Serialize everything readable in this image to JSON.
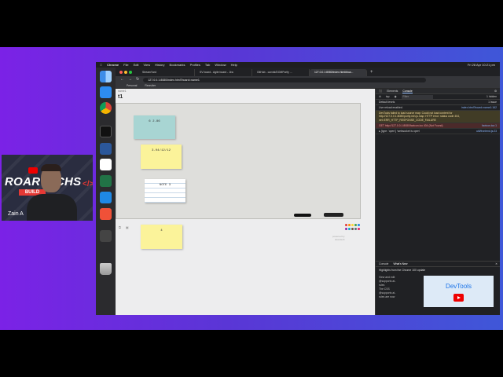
{
  "menubar": {
    "app": "Chrome",
    "items": [
      "File",
      "Edit",
      "View",
      "History",
      "Bookmarks",
      "Profiles",
      "Tab",
      "Window",
      "Help"
    ],
    "clock": "Fri 28 Apr 10:21 pm"
  },
  "tabs": [
    {
      "label": "StreamYard"
    },
    {
      "label": "SV board - Agile board - Jira"
    },
    {
      "label": "GitHub - curvist/DOMPurify ..."
    },
    {
      "label": "127.0.0.1:8080/index.html#boa..."
    }
  ],
  "toolbar": {
    "url": "127.0.0.1:8080/index.html?board=name1"
  },
  "bookmarks": [
    "Personal",
    "Recruiter"
  ],
  "page": {
    "label": "name1",
    "title": "t1",
    "notes": [
      {
        "text": "6 2.86"
      },
      {
        "text": "3.04/12/12"
      },
      {
        "text": "NOTE 3"
      },
      {
        "text": "4"
      }
    ],
    "watermark": [
      "powered by",
      "dowelsoft"
    ],
    "colors": [
      "#e53935",
      "#fb8c00",
      "#fdd835",
      "#43a047",
      "#1e88e5",
      "#8e24aa",
      "#00acc1",
      "#6d4c41",
      "#546e7a",
      "#e91e63"
    ]
  },
  "devtools": {
    "tabs": [
      "Elements",
      "Console"
    ],
    "context": "top",
    "filter_placeholder": "Filter",
    "issues": "1 Issue",
    "levels": "Default levels",
    "hidden": "1 hidden",
    "logs": [
      {
        "kind": "info",
        "text": "Live reload enabled.",
        "src": "index.html?board=name1:162"
      },
      {
        "kind": "warn",
        "text": "DevTools failed to load source map: Could not load content for http://127.0.0.1:8080/purify.min.js.map: HTTP error: status code 404, net::ERR_HTTP_RESPONSE_CODE_FAILURE",
        "src": ""
      },
      {
        "kind": "err",
        "text": "GET http://127.0.0.1:8080/favicon.ico 404 (Not Found)",
        "src": "favicon.ico:1"
      },
      {
        "kind": "info",
        "text": "▸ {type: 'open'} 'websocket is open'",
        "src": "util/frontend.js:23"
      }
    ],
    "drawer_tabs": [
      "Console",
      "What's New"
    ],
    "drawer_headline": "Highlights from the Chrome 100 update",
    "drawer_links": [
      "View and edit",
      "@supports at-",
      "rules",
      "The CSS",
      "@supports at-",
      "rules are now"
    ],
    "drawer_card": "DevTools"
  },
  "webcam": {
    "title": "ROARTECHS",
    "subtitle": "BUILD",
    "name": "Zain A"
  },
  "colors": {
    "background_gradient_start": "#7b22e6",
    "background_gradient_end": "#3f57d8",
    "accent_red": "#e53935"
  }
}
